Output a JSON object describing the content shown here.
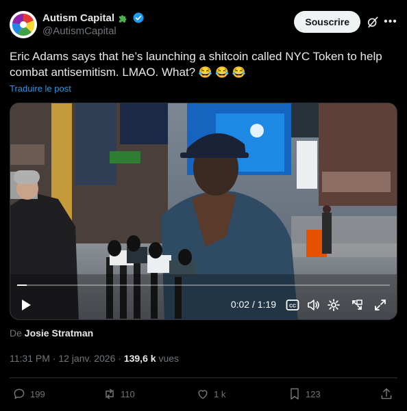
{
  "author": {
    "display_name": "Autism Capital",
    "handle": "@AutismCapital",
    "badge_icon": "puzzle-piece-icon",
    "verified_icon": "verified-badge-icon",
    "verified_color": "#1d9bf0"
  },
  "header": {
    "subscribe_label": "Souscrire",
    "grok_icon": "grok-icon",
    "more_icon": "more-icon"
  },
  "tweet": {
    "text": "Eric Adams says that he’s launching a shitcoin called NYC Token to help combat antisemitism. LMAO. What?",
    "emoji": "😂 😂 😂",
    "translate_label": "Traduire le post"
  },
  "video": {
    "timecode": "0:02 / 1:19",
    "progress": 0.025,
    "icons": [
      "play-icon",
      "captions-icon",
      "volume-icon",
      "settings-icon",
      "pop-out-icon",
      "fullscreen-icon"
    ]
  },
  "byline": {
    "prefix": "De",
    "name": "Josie Stratman"
  },
  "meta": {
    "time": "11:31 PM",
    "separator": "·",
    "date": "12 janv. 2026",
    "views_count": "139,6 k",
    "views_label": "vues"
  },
  "actions": {
    "replies": "199",
    "reposts": "110",
    "likes": "1 k",
    "bookmarks": "123"
  },
  "colors": {
    "background": "#000000",
    "text": "#e7e9ea",
    "muted": "#71767b",
    "link": "#1d9bf0",
    "accent_green": "#4caf50"
  }
}
